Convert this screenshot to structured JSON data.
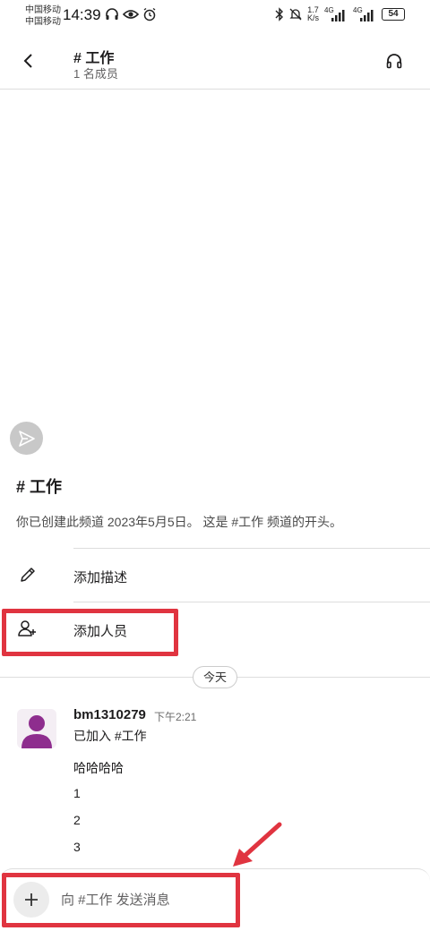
{
  "status_bar": {
    "carrier_1": "中国移动",
    "carrier_2": "中国移动",
    "time": "14:39",
    "net_speed_value": "1.7",
    "net_speed_unit": "K/s",
    "signal_1": "4G",
    "signal_2": "4G",
    "battery": "54"
  },
  "header": {
    "title": "# 工作",
    "subtitle": "1 名成员",
    "back_icon": "chevron-left-icon",
    "headphones_icon": "headphones-icon"
  },
  "intro": {
    "channel_name": "# 工作",
    "description": "你已创建此频道 2023年5月5日。 这是 #工作 频道的开头。",
    "add_description_label": "添加描述",
    "add_people_label": "添加人员"
  },
  "date_separator": "今天",
  "message": {
    "username": "bm1310279",
    "time": "下午2:21",
    "joined": "已加入 #工作",
    "lines": [
      "哈哈哈哈",
      "1",
      "2",
      "3"
    ]
  },
  "composer": {
    "placeholder": "向 #工作 发送消息"
  },
  "colors": {
    "highlight": "#e03440",
    "avatar": "#8e2d8e",
    "divider": "#dddddd"
  }
}
